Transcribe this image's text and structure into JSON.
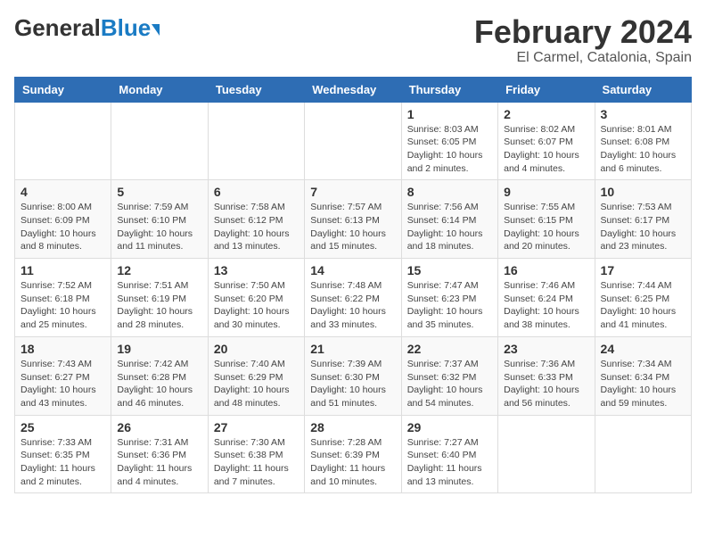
{
  "app": {
    "logo_general": "General",
    "logo_blue": "Blue",
    "month_title": "February 2024",
    "location": "El Carmel, Catalonia, Spain"
  },
  "calendar": {
    "headers": [
      "Sunday",
      "Monday",
      "Tuesday",
      "Wednesday",
      "Thursday",
      "Friday",
      "Saturday"
    ],
    "weeks": [
      [
        {
          "day": "",
          "info": ""
        },
        {
          "day": "",
          "info": ""
        },
        {
          "day": "",
          "info": ""
        },
        {
          "day": "",
          "info": ""
        },
        {
          "day": "1",
          "info": "Sunrise: 8:03 AM\nSunset: 6:05 PM\nDaylight: 10 hours and 2 minutes."
        },
        {
          "day": "2",
          "info": "Sunrise: 8:02 AM\nSunset: 6:07 PM\nDaylight: 10 hours and 4 minutes."
        },
        {
          "day": "3",
          "info": "Sunrise: 8:01 AM\nSunset: 6:08 PM\nDaylight: 10 hours and 6 minutes."
        }
      ],
      [
        {
          "day": "4",
          "info": "Sunrise: 8:00 AM\nSunset: 6:09 PM\nDaylight: 10 hours and 8 minutes."
        },
        {
          "day": "5",
          "info": "Sunrise: 7:59 AM\nSunset: 6:10 PM\nDaylight: 10 hours and 11 minutes."
        },
        {
          "day": "6",
          "info": "Sunrise: 7:58 AM\nSunset: 6:12 PM\nDaylight: 10 hours and 13 minutes."
        },
        {
          "day": "7",
          "info": "Sunrise: 7:57 AM\nSunset: 6:13 PM\nDaylight: 10 hours and 15 minutes."
        },
        {
          "day": "8",
          "info": "Sunrise: 7:56 AM\nSunset: 6:14 PM\nDaylight: 10 hours and 18 minutes."
        },
        {
          "day": "9",
          "info": "Sunrise: 7:55 AM\nSunset: 6:15 PM\nDaylight: 10 hours and 20 minutes."
        },
        {
          "day": "10",
          "info": "Sunrise: 7:53 AM\nSunset: 6:17 PM\nDaylight: 10 hours and 23 minutes."
        }
      ],
      [
        {
          "day": "11",
          "info": "Sunrise: 7:52 AM\nSunset: 6:18 PM\nDaylight: 10 hours and 25 minutes."
        },
        {
          "day": "12",
          "info": "Sunrise: 7:51 AM\nSunset: 6:19 PM\nDaylight: 10 hours and 28 minutes."
        },
        {
          "day": "13",
          "info": "Sunrise: 7:50 AM\nSunset: 6:20 PM\nDaylight: 10 hours and 30 minutes."
        },
        {
          "day": "14",
          "info": "Sunrise: 7:48 AM\nSunset: 6:22 PM\nDaylight: 10 hours and 33 minutes."
        },
        {
          "day": "15",
          "info": "Sunrise: 7:47 AM\nSunset: 6:23 PM\nDaylight: 10 hours and 35 minutes."
        },
        {
          "day": "16",
          "info": "Sunrise: 7:46 AM\nSunset: 6:24 PM\nDaylight: 10 hours and 38 minutes."
        },
        {
          "day": "17",
          "info": "Sunrise: 7:44 AM\nSunset: 6:25 PM\nDaylight: 10 hours and 41 minutes."
        }
      ],
      [
        {
          "day": "18",
          "info": "Sunrise: 7:43 AM\nSunset: 6:27 PM\nDaylight: 10 hours and 43 minutes."
        },
        {
          "day": "19",
          "info": "Sunrise: 7:42 AM\nSunset: 6:28 PM\nDaylight: 10 hours and 46 minutes."
        },
        {
          "day": "20",
          "info": "Sunrise: 7:40 AM\nSunset: 6:29 PM\nDaylight: 10 hours and 48 minutes."
        },
        {
          "day": "21",
          "info": "Sunrise: 7:39 AM\nSunset: 6:30 PM\nDaylight: 10 hours and 51 minutes."
        },
        {
          "day": "22",
          "info": "Sunrise: 7:37 AM\nSunset: 6:32 PM\nDaylight: 10 hours and 54 minutes."
        },
        {
          "day": "23",
          "info": "Sunrise: 7:36 AM\nSunset: 6:33 PM\nDaylight: 10 hours and 56 minutes."
        },
        {
          "day": "24",
          "info": "Sunrise: 7:34 AM\nSunset: 6:34 PM\nDaylight: 10 hours and 59 minutes."
        }
      ],
      [
        {
          "day": "25",
          "info": "Sunrise: 7:33 AM\nSunset: 6:35 PM\nDaylight: 11 hours and 2 minutes."
        },
        {
          "day": "26",
          "info": "Sunrise: 7:31 AM\nSunset: 6:36 PM\nDaylight: 11 hours and 4 minutes."
        },
        {
          "day": "27",
          "info": "Sunrise: 7:30 AM\nSunset: 6:38 PM\nDaylight: 11 hours and 7 minutes."
        },
        {
          "day": "28",
          "info": "Sunrise: 7:28 AM\nSunset: 6:39 PM\nDaylight: 11 hours and 10 minutes."
        },
        {
          "day": "29",
          "info": "Sunrise: 7:27 AM\nSunset: 6:40 PM\nDaylight: 11 hours and 13 minutes."
        },
        {
          "day": "",
          "info": ""
        },
        {
          "day": "",
          "info": ""
        }
      ]
    ]
  }
}
